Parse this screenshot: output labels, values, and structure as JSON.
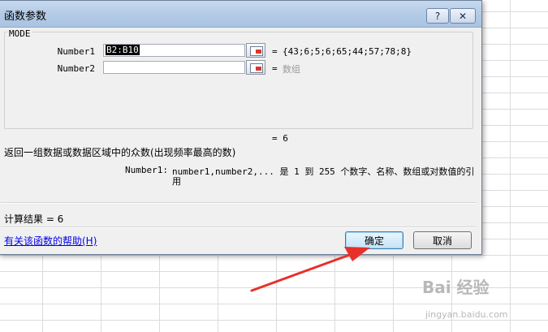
{
  "dialog": {
    "title": "函数参数",
    "help_btn": "?",
    "close_btn": "✕",
    "function_name": "MODE",
    "args": [
      {
        "label": "Number1",
        "value": "B2:B10",
        "eq": "=",
        "result": "{43;6;5;6;65;44;57;78;8}"
      },
      {
        "label": "Number2",
        "value": "",
        "eq": "=",
        "result": "数组"
      }
    ],
    "formula_result_line": "=  6",
    "description": "返回一组数据或数据区域中的众数(出现频率最高的数)",
    "arg_help_name": "Number1:",
    "arg_help_text": "number1,number2,...  是 1 到 255 个数字、名称、数组或对数值的引",
    "arg_help_wrap": "用",
    "calc_result": "计算结果 =  6",
    "help_link": "有关该函数的帮助(H)",
    "ok": "确定",
    "cancel": "取消"
  },
  "watermark": {
    "brand": "Bai  经验",
    "url": "jingyan.baidu.com"
  },
  "icons": [
    "ref-select-icon",
    "help-icon",
    "close-icon",
    "red-arrow"
  ]
}
